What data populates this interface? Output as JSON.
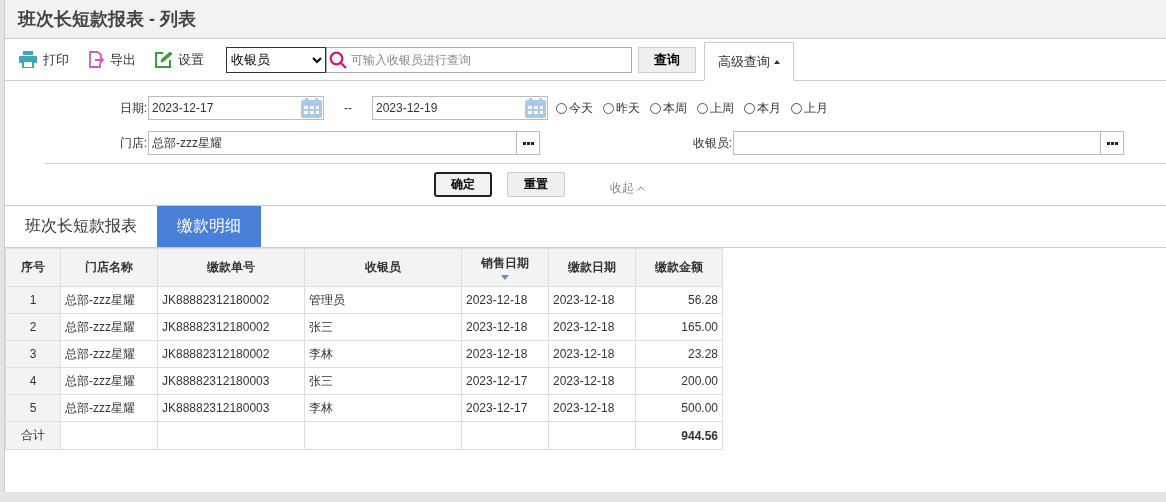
{
  "title": "班次长短款报表 - 列表",
  "toolbar": {
    "actions": [
      {
        "kind": "print",
        "label": "打印"
      },
      {
        "kind": "export",
        "label": "导出"
      },
      {
        "kind": "settings",
        "label": "设置"
      }
    ],
    "search_type": {
      "value": "收银员"
    },
    "search": {
      "placeholder": "可输入收银员进行查询"
    },
    "query_button": "查询",
    "advanced": {
      "label": "高级查询",
      "expanded": true
    }
  },
  "filters": {
    "date_label": "日期:",
    "date_from": "2023-12-17",
    "separator": "--",
    "date_to": "2023-12-19",
    "quick_ranges": [
      {
        "label": "今天",
        "selected": false
      },
      {
        "label": "昨天",
        "selected": false
      },
      {
        "label": "本周",
        "selected": false
      },
      {
        "label": "上周",
        "selected": false
      },
      {
        "label": "本月",
        "selected": false
      },
      {
        "label": "上月",
        "selected": false
      }
    ],
    "store_label": "门店:",
    "store_value": "总部-zzz星耀",
    "cashier_label": "收银员:",
    "confirm_button": "确定",
    "reset_button": "重置",
    "collapse_link": "收起"
  },
  "tabs": [
    {
      "label": "班次长短款报表",
      "selected": false
    },
    {
      "label": "缴款明细",
      "selected": true
    }
  ],
  "table": {
    "columns": [
      {
        "label": "序号",
        "sorted": false
      },
      {
        "label": "门店名称",
        "sorted": false
      },
      {
        "label": "缴款单号",
        "sorted": false
      },
      {
        "label": "收银员",
        "sorted": false
      },
      {
        "label": "销售日期",
        "sorted": true
      },
      {
        "label": "缴款日期",
        "sorted": false
      },
      {
        "label": "缴款金额",
        "sorted": false
      }
    ],
    "rows": [
      [
        "1",
        "总部-zzz星耀",
        "JK88882312180002",
        "管理员",
        "2023-12-18",
        "2023-12-18",
        "56.28"
      ],
      [
        "2",
        "总部-zzz星耀",
        "JK88882312180002",
        "张三",
        "2023-12-18",
        "2023-12-18",
        "165.00"
      ],
      [
        "3",
        "总部-zzz星耀",
        "JK88882312180002",
        "李林",
        "2023-12-18",
        "2023-12-18",
        "23.28"
      ],
      [
        "4",
        "总部-zzz星耀",
        "JK88882312180003",
        "张三",
        "2023-12-17",
        "2023-12-18",
        "200.00"
      ],
      [
        "5",
        "总部-zzz星耀",
        "JK88882312180003",
        "李林",
        "2023-12-17",
        "2023-12-18",
        "500.00"
      ]
    ],
    "total": {
      "label": "合计",
      "amount": "944.56"
    }
  }
}
